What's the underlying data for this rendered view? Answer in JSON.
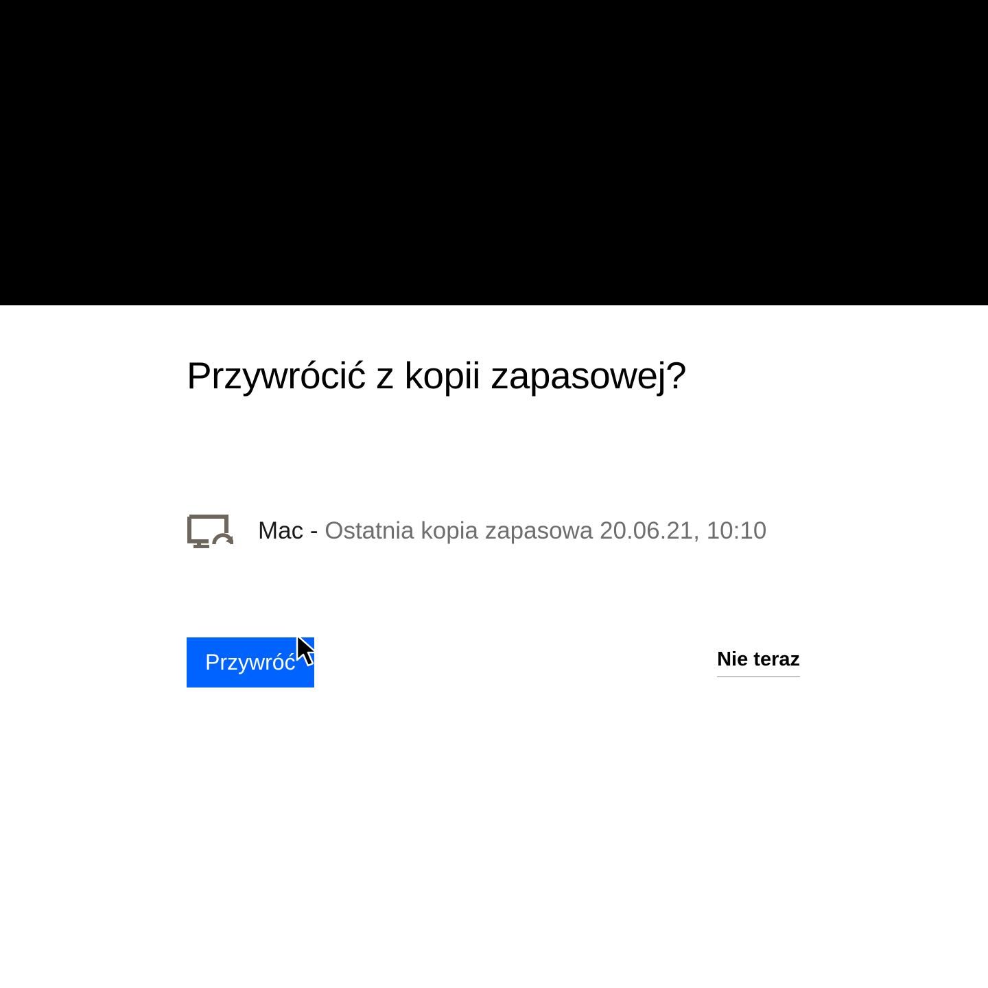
{
  "dialog": {
    "title": "Przywrócić z kopii zapasowej?",
    "backup": {
      "device": "Mac",
      "separator": " - ",
      "detail": "Ostatnia kopia zapasowa 20.06.21, 10:10"
    },
    "restore_label": "Przywróć",
    "skip_label": "Nie teraz"
  }
}
